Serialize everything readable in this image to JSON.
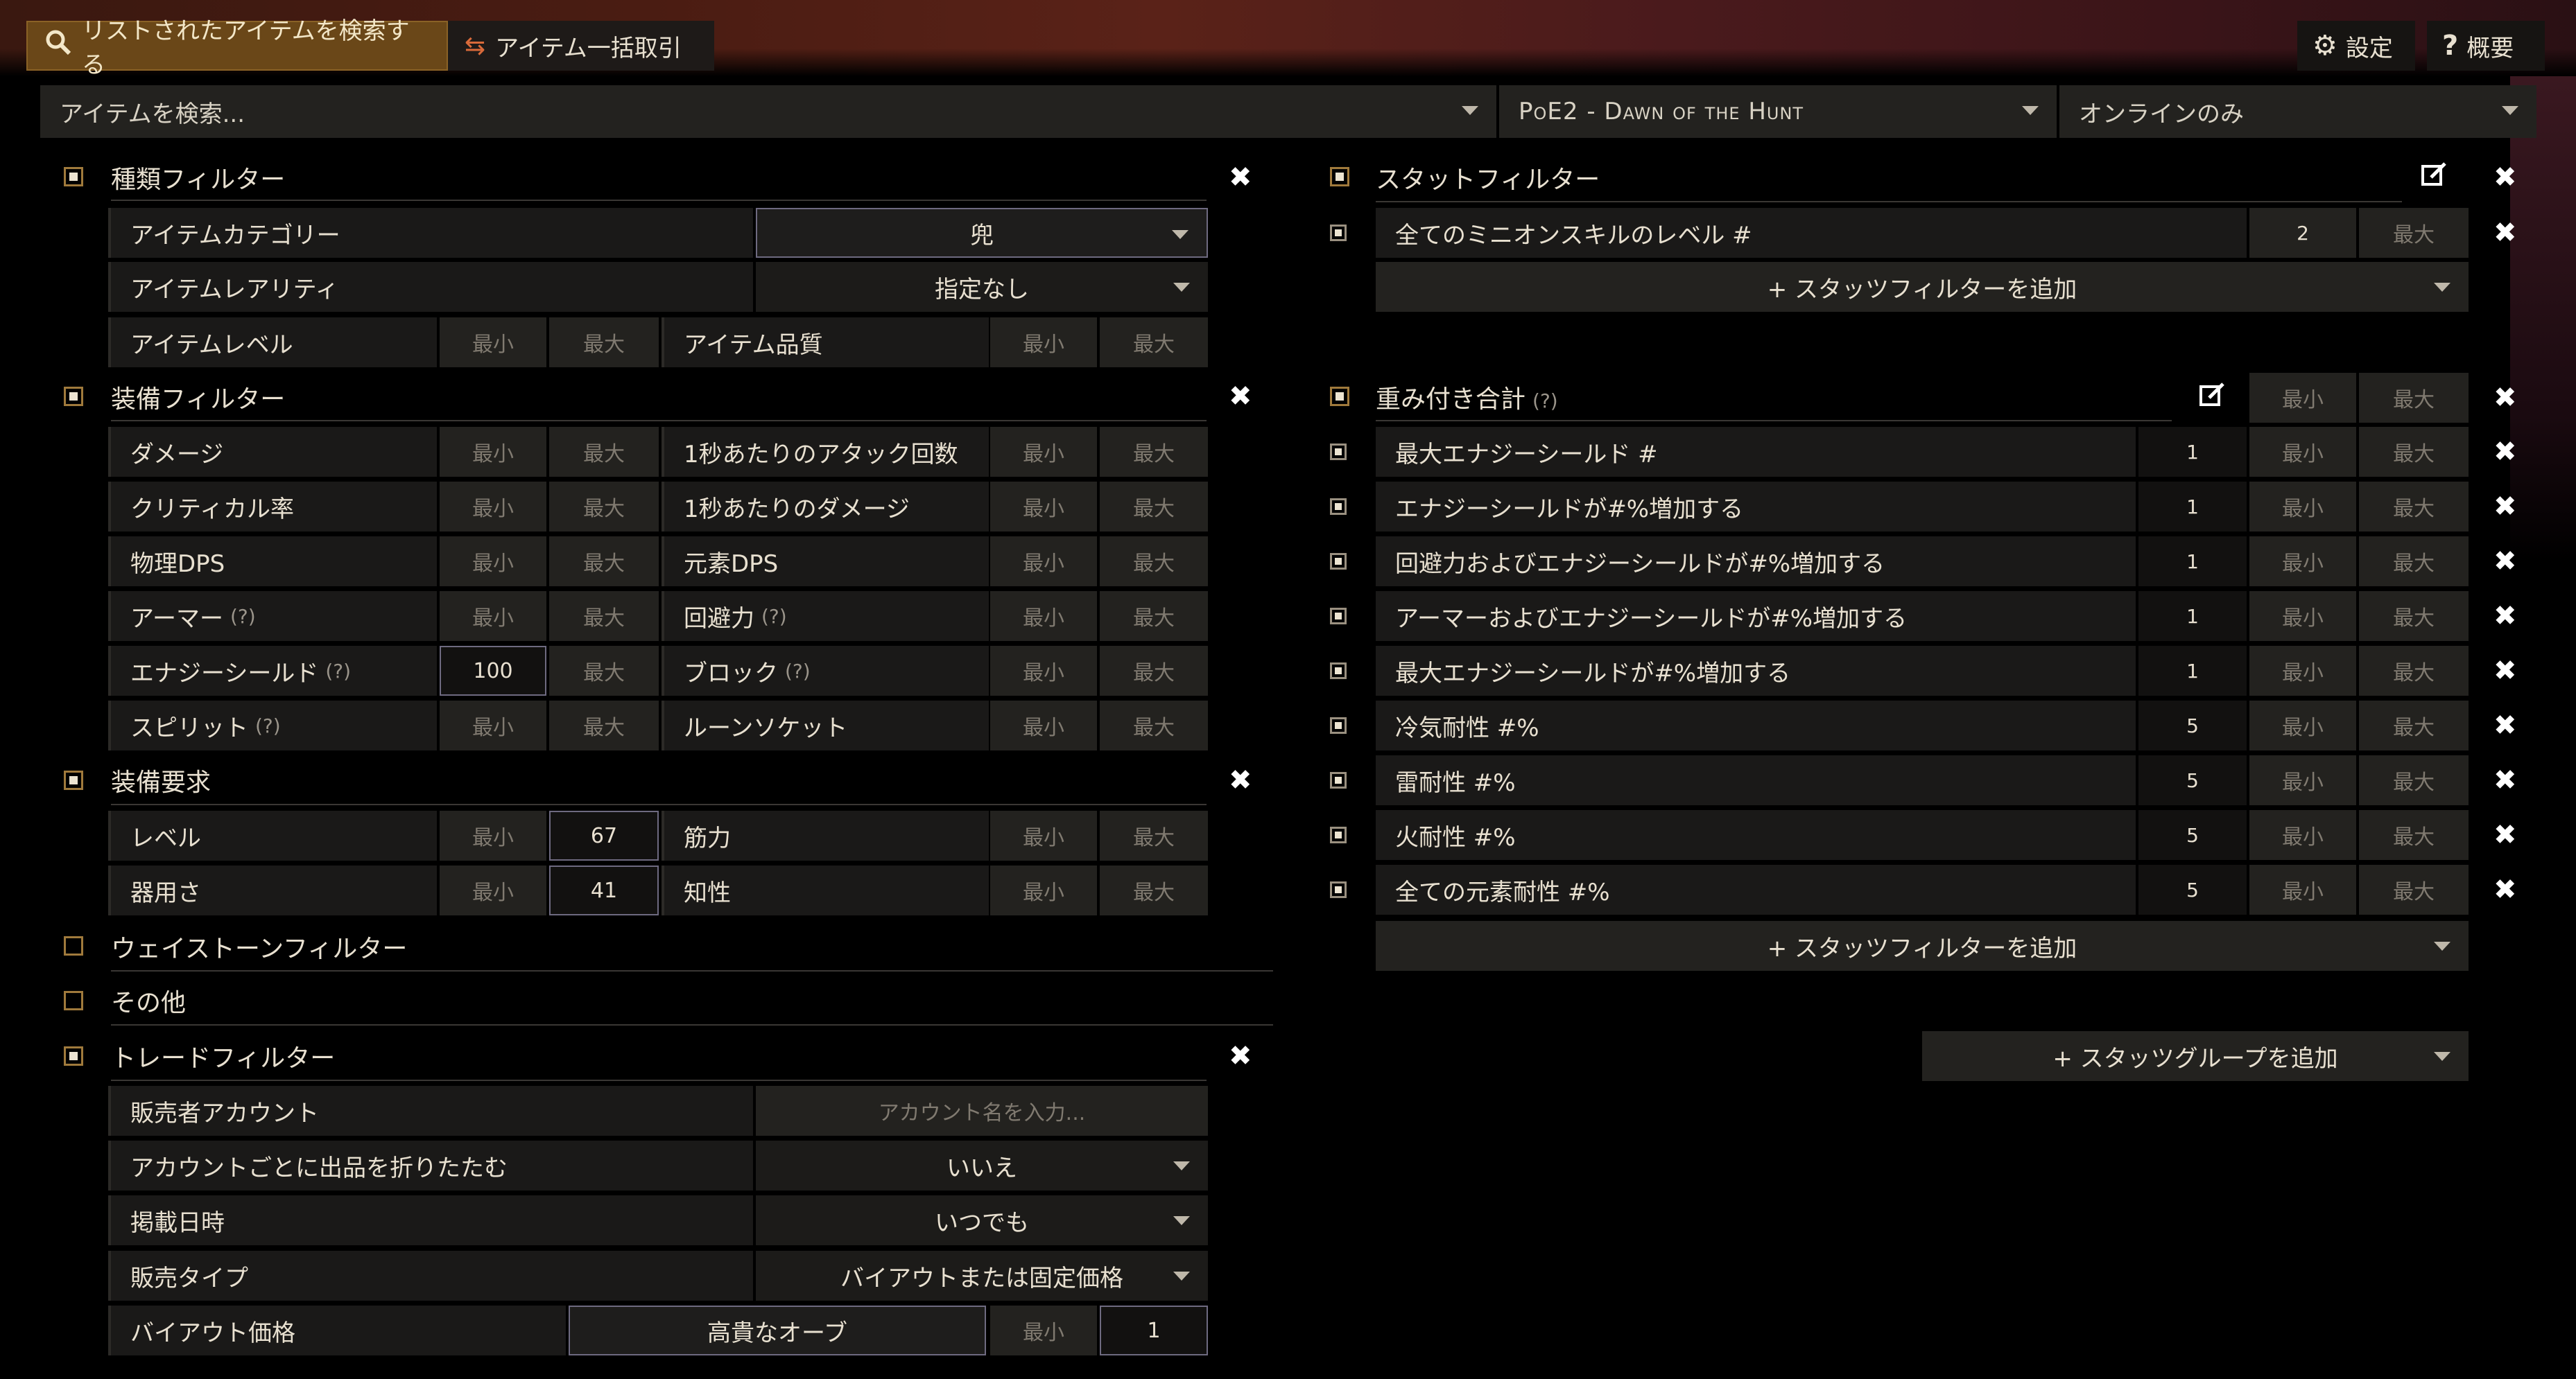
{
  "tabs": {
    "search": "リストされたアイテムを検索する",
    "bulk": "アイテム一括取引"
  },
  "topnav": {
    "settings": "設定",
    "about": "概要"
  },
  "search": {
    "placeholder": "アイテムを検索...",
    "league": "PoE2 - Dawn of the Hunt",
    "status": "オンラインのみ"
  },
  "type_filters": {
    "title": "種類フィルター",
    "category_label": "アイテムカテゴリー",
    "category_value": "兜",
    "rarity_label": "アイテムレアリティ",
    "rarity_value": "指定なし",
    "ilvl_label": "アイテムレベル",
    "quality_label": "アイテム品質"
  },
  "minmax": {
    "min": "最小",
    "max": "最大"
  },
  "help_mark": "(?)",
  "equipment": {
    "title": "装備フィルター",
    "rows": [
      {
        "left": "ダメージ",
        "left_help": false,
        "left_min": "",
        "right": "1秒あたりのアタック回数",
        "right_help": false
      },
      {
        "left": "クリティカル率",
        "left_help": false,
        "left_min": "",
        "right": "1秒あたりのダメージ",
        "right_help": false
      },
      {
        "left": "物理DPS",
        "left_help": false,
        "left_min": "",
        "right": "元素DPS",
        "right_help": false
      },
      {
        "left": "アーマー",
        "left_help": true,
        "left_min": "",
        "right": "回避力",
        "right_help": true
      },
      {
        "left": "エナジーシールド",
        "left_help": true,
        "left_min": "100",
        "right": "ブロック",
        "right_help": true
      },
      {
        "left": "スピリット",
        "left_help": true,
        "left_min": "",
        "right": "ルーンソケット",
        "right_help": false
      }
    ]
  },
  "requirements": {
    "title": "装備要求",
    "level_label": "レベル",
    "level_max": "67",
    "str_label": "筋力",
    "dex_label": "器用さ",
    "dex_max": "41",
    "int_label": "知性"
  },
  "waystone": {
    "title": "ウェイストーンフィルター"
  },
  "misc": {
    "title": "その他"
  },
  "trade": {
    "title": "トレードフィルター",
    "seller_label": "販売者アカウント",
    "seller_placeholder": "アカウント名を入力...",
    "collapse_label": "アカウントごとに出品を折りたたむ",
    "collapse_value": "いいえ",
    "listed_label": "掲載日時",
    "listed_value": "いつでも",
    "sale_label": "販売タイプ",
    "sale_value": "バイアウトまたは固定価格",
    "buyout_label": "バイアウト価格",
    "buyout_currency": "高貴なオーブ",
    "buyout_max": "1"
  },
  "stat_filters": {
    "title": "スタットフィルター",
    "row_label": "全てのミニオンスキルのレベル #",
    "row_min": "2",
    "add_label": "+ スタッツフィルターを追加"
  },
  "weighted": {
    "title": "重み付き合計",
    "rows": [
      {
        "label": "最大エナジーシールド #",
        "weight": "1"
      },
      {
        "label": "エナジーシールドが#%増加する",
        "weight": "1"
      },
      {
        "label": "回避力およびエナジーシールドが#%増加する",
        "weight": "1"
      },
      {
        "label": "アーマーおよびエナジーシールドが#%増加する",
        "weight": "1"
      },
      {
        "label": "最大エナジーシールドが#%増加する",
        "weight": "1"
      },
      {
        "label": "冷気耐性 #%",
        "weight": "5"
      },
      {
        "label": "雷耐性 #%",
        "weight": "5"
      },
      {
        "label": "火耐性 #%",
        "weight": "5"
      },
      {
        "label": "全ての元素耐性 #%",
        "weight": "5"
      }
    ],
    "add_label": "+ スタッツフィルターを追加",
    "group_label": "+ スタッツグループを追加"
  }
}
